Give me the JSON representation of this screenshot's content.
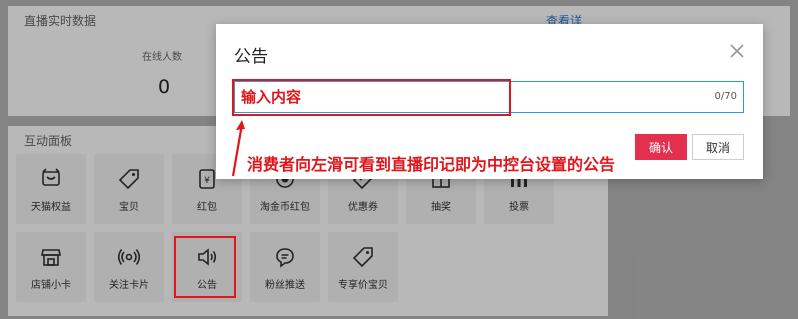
{
  "live_panel": {
    "title": "直播实时数据",
    "view_details": "查看详",
    "online_label": "在线人数",
    "online_value": "0"
  },
  "interact_panel": {
    "title": "互动面板",
    "tiles": [
      {
        "label": "天猫权益",
        "icon": "tmall-icon"
      },
      {
        "label": "宝贝",
        "icon": "tag-icon"
      },
      {
        "label": "红包",
        "icon": "red-packet-icon"
      },
      {
        "label": "淘金币红包",
        "icon": "coin-icon"
      },
      {
        "label": "优惠券",
        "icon": "coupon-icon"
      },
      {
        "label": "抽奖",
        "icon": "lottery-icon"
      },
      {
        "label": "投票",
        "icon": "vote-icon"
      },
      {
        "label": "店铺小卡",
        "icon": "shop-icon"
      },
      {
        "label": "关注卡片",
        "icon": "broadcast-icon"
      },
      {
        "label": "公告",
        "icon": "speaker-icon"
      },
      {
        "label": "粉丝推送",
        "icon": "chat-icon"
      },
      {
        "label": "专享价宝贝",
        "icon": "price-tag-icon"
      }
    ]
  },
  "dialog": {
    "title": "公告",
    "input_placeholder": "输入内容",
    "input_value": "",
    "counter": "0/70",
    "confirm_label": "确认",
    "cancel_label": "取消"
  },
  "annotation": {
    "text": "消费者向左滑可看到直播印记即为中控台设置的公告",
    "color": "#e0161d"
  },
  "colors": {
    "accent": "#e3304e",
    "highlight": "#e0161d",
    "input_border": "#2f9ad8"
  }
}
